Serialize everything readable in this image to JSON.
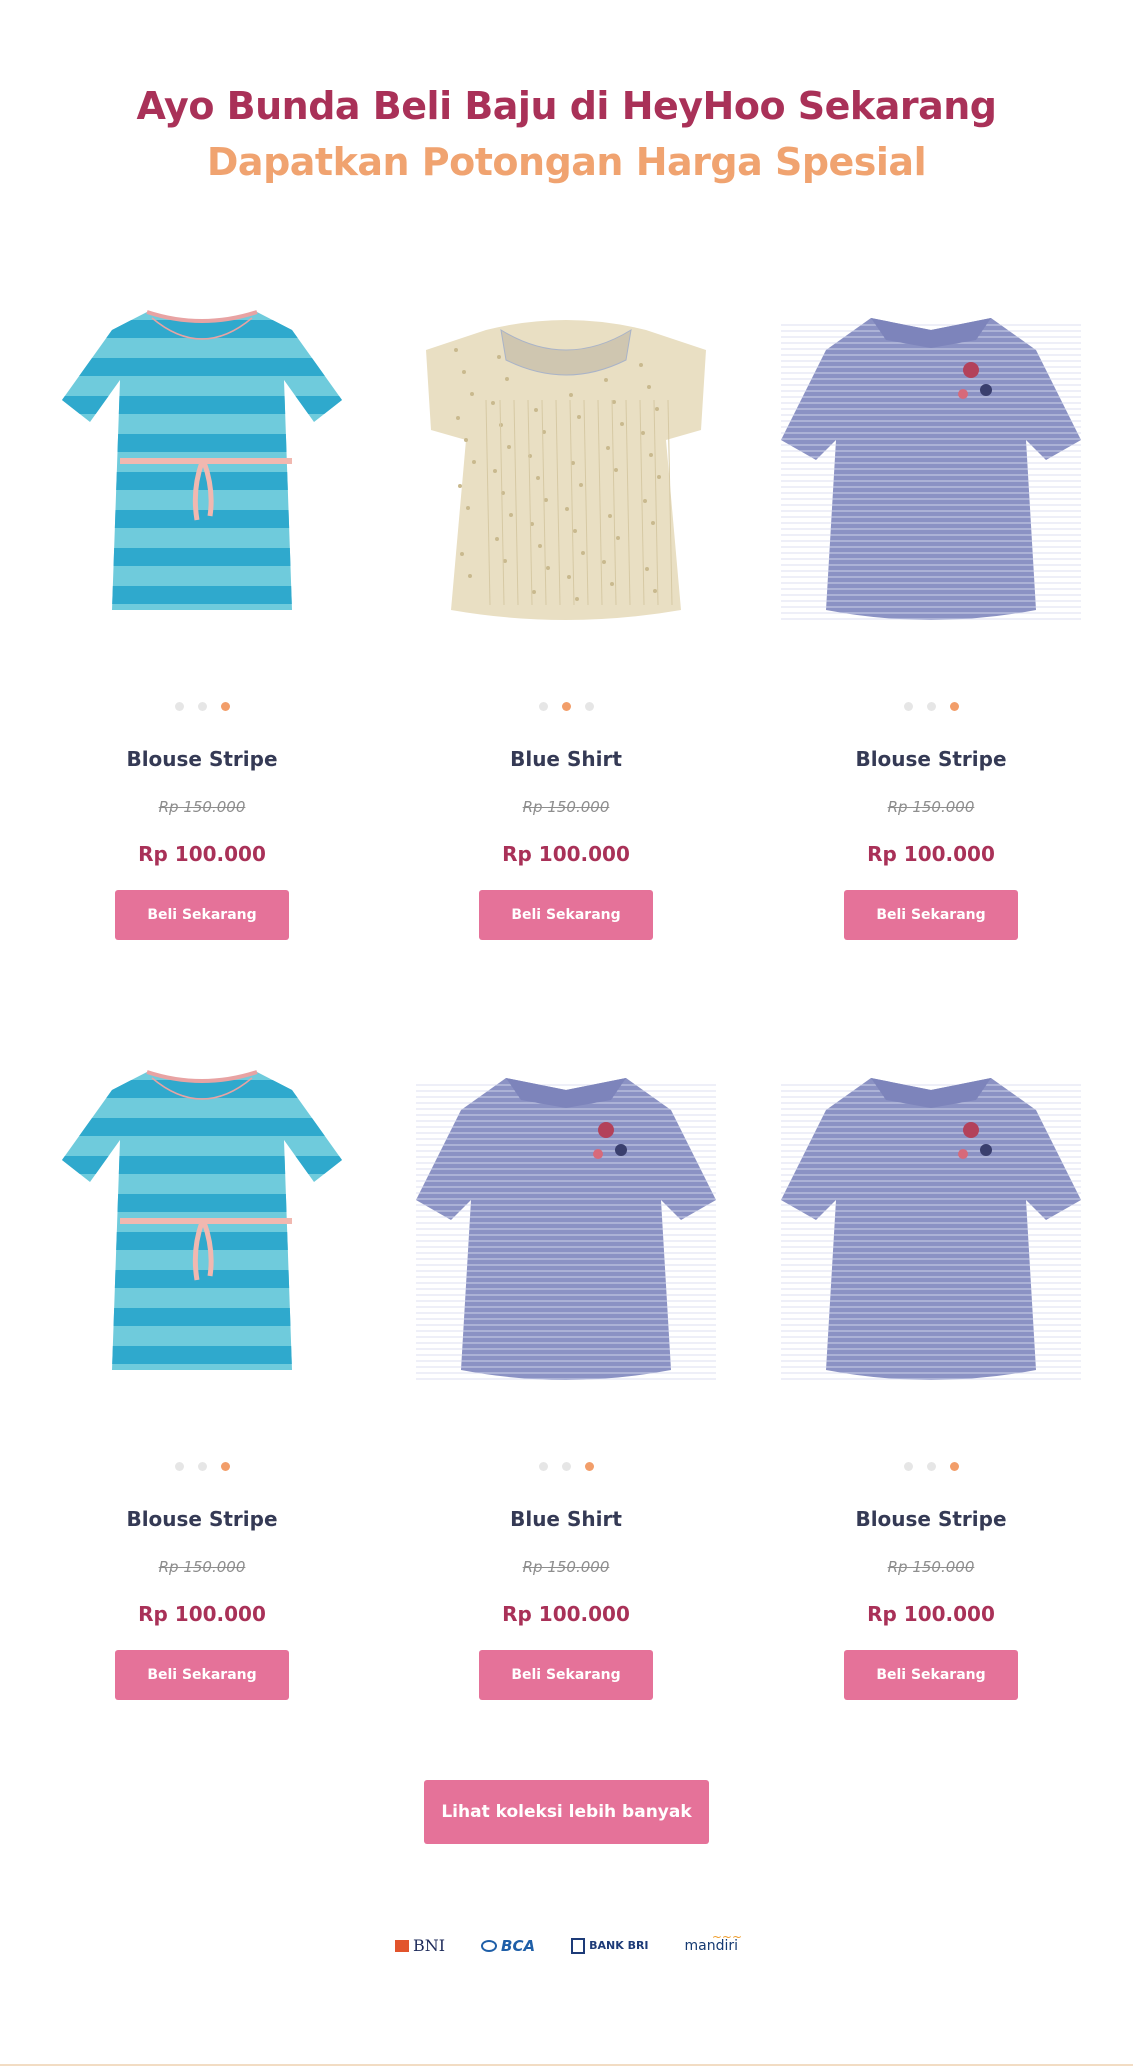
{
  "headline": {
    "line1": "Ayo Bunda Beli Baju di HeyHoo Sekarang",
    "line2": "Dapatkan Potongan Harga Spesial"
  },
  "products": [
    {
      "name": "Blouse Stripe",
      "old_price": "Rp 150.000",
      "price": "Rp 100.000",
      "button": "Beli Sekarang",
      "image": "striped-turquoise-dress",
      "active_dot": 3
    },
    {
      "name": "Blue Shirt",
      "old_price": "Rp 150.000",
      "price": "Rp 100.000",
      "button": "Beli Sekarang",
      "image": "beige-floral-blouse",
      "active_dot": 2
    },
    {
      "name": "Blouse Stripe",
      "old_price": "Rp 150.000",
      "price": "Rp 100.000",
      "button": "Beli Sekarang",
      "image": "blue-striped-ruffle-blouse",
      "active_dot": 3
    },
    {
      "name": "Blouse Stripe",
      "old_price": "Rp 150.000",
      "price": "Rp 100.000",
      "button": "Beli Sekarang",
      "image": "striped-turquoise-dress",
      "active_dot": 3
    },
    {
      "name": "Blue Shirt",
      "old_price": "Rp 150.000",
      "price": "Rp 100.000",
      "button": "Beli Sekarang",
      "image": "blue-striped-ruffle-blouse",
      "active_dot": 3
    },
    {
      "name": "Blouse Stripe",
      "old_price": "Rp 150.000",
      "price": "Rp 100.000",
      "button": "Beli Sekarang",
      "image": "blue-striped-ruffle-blouse",
      "active_dot": 3
    }
  ],
  "more_button": "Lihat koleksi lebih banyak",
  "banks": {
    "bni": "BNI",
    "bca": "BCA",
    "bri": "BANK BRI",
    "mandiri": "mandiri"
  },
  "colors": {
    "headline_primary": "#a93158",
    "headline_secondary": "#f0a370",
    "button": "#e57299",
    "price": "#a93158",
    "dot_active": "#f29e6a"
  }
}
